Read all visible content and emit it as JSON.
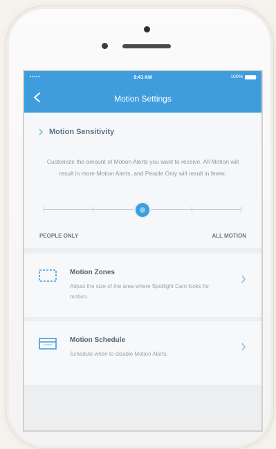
{
  "status_bar": {
    "signal": "•••••",
    "time": "9:41 AM",
    "battery": "100%"
  },
  "nav": {
    "title": "Motion Settings",
    "back_icon": "chevron-left-icon"
  },
  "sensitivity": {
    "title": "Motion Sensitivity",
    "description": "Customize the amount of Motion Alerts you want to receive. All Motion will result in more Motion Alerts, and People Only will result in fewer.",
    "slider": {
      "min_label": "PEOPLE ONLY",
      "max_label": "ALL MOTION",
      "steps": 5,
      "value_index": 2
    }
  },
  "rows": [
    {
      "title": "Motion Zones",
      "description": "Adjust the size of the area where Spotlight Cam looks for motion.",
      "icon": "motion-zones-icon"
    },
    {
      "title": "Motion Schedule",
      "description": "Schedule when to disable Motion Alerts.",
      "icon": "calendar-icon"
    }
  ],
  "colors": {
    "accent": "#3f9ddd",
    "title_text": "#4f6475",
    "muted_text": "#8a97a3"
  }
}
